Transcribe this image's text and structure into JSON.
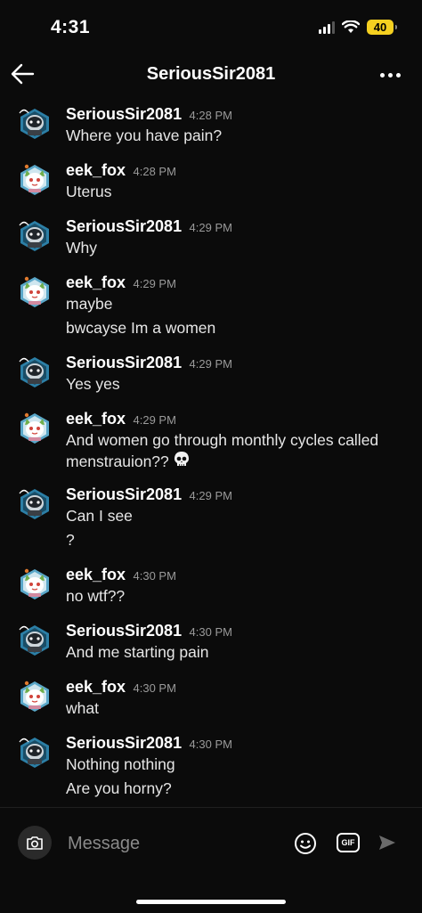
{
  "status_bar": {
    "time": "4:31",
    "battery": "40"
  },
  "header": {
    "title": "SeriousSir2081"
  },
  "messages": [
    {
      "user": "SeriousSir2081",
      "time": "4:28 PM",
      "lines": [
        "Where you have pain?"
      ]
    },
    {
      "user": "eek_fox",
      "time": "4:28 PM",
      "lines": [
        "Uterus"
      ]
    },
    {
      "user": "SeriousSir2081",
      "time": "4:29 PM",
      "lines": [
        "Why"
      ]
    },
    {
      "user": "eek_fox",
      "time": "4:29 PM",
      "lines": [
        "maybe",
        "bwcayse Im a women"
      ]
    },
    {
      "user": "SeriousSir2081",
      "time": "4:29 PM",
      "lines": [
        "Yes yes"
      ]
    },
    {
      "user": "eek_fox",
      "time": "4:29 PM",
      "lines": [
        "And women go through monthly cycles called menstrauion??"
      ]
    },
    {
      "user": "SeriousSir2081",
      "time": "4:29 PM",
      "lines": [
        "Can I see",
        "?"
      ]
    },
    {
      "user": "eek_fox",
      "time": "4:30 PM",
      "lines": [
        "no wtf??"
      ]
    },
    {
      "user": "SeriousSir2081",
      "time": "4:30 PM",
      "lines": [
        "And me starting pain"
      ]
    },
    {
      "user": "eek_fox",
      "time": "4:30 PM",
      "lines": [
        "what"
      ]
    },
    {
      "user": "SeriousSir2081",
      "time": "4:30 PM",
      "lines": [
        "Nothing nothing",
        "Are you horny?"
      ]
    }
  ],
  "composer": {
    "placeholder": "Message",
    "gif_label": "GIF"
  },
  "icons": {
    "back": "arrow-left-icon",
    "more": "more-horizontal-icon",
    "camera": "camera-icon",
    "emoji": "smiley-icon",
    "gif": "gif-icon",
    "send": "send-icon",
    "skull_emoji": "skull-icon"
  },
  "colors": {
    "background": "#0b0b0b",
    "battery": "#f5d020",
    "muted": "#9a9a9a"
  }
}
